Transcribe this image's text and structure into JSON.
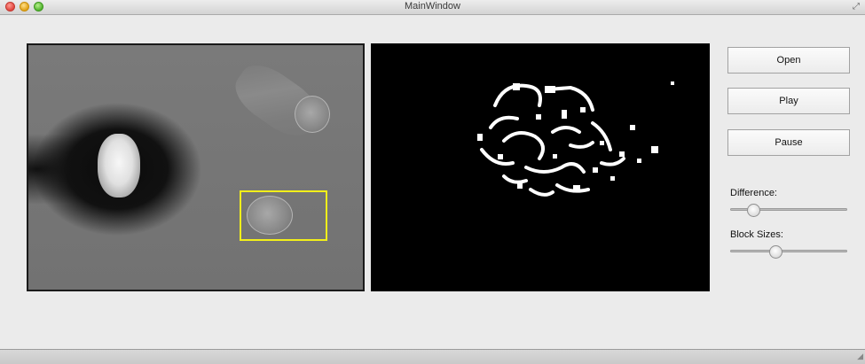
{
  "window": {
    "title": "MainWindow"
  },
  "buttons": {
    "open_label": "Open",
    "play_label": "Play",
    "pause_label": "Pause"
  },
  "sliders": {
    "difference": {
      "label": "Difference:",
      "value_fraction": 0.16
    },
    "block_sizes": {
      "label": "Block Sizes:",
      "value_fraction": 0.38
    }
  },
  "colors": {
    "selection_box": "#f2ef1a",
    "mask_background": "#000000",
    "mask_foreground": "#ffffff"
  },
  "icons": [
    "close-icon",
    "minimize-icon",
    "zoom-icon",
    "fullscreen-icon"
  ]
}
